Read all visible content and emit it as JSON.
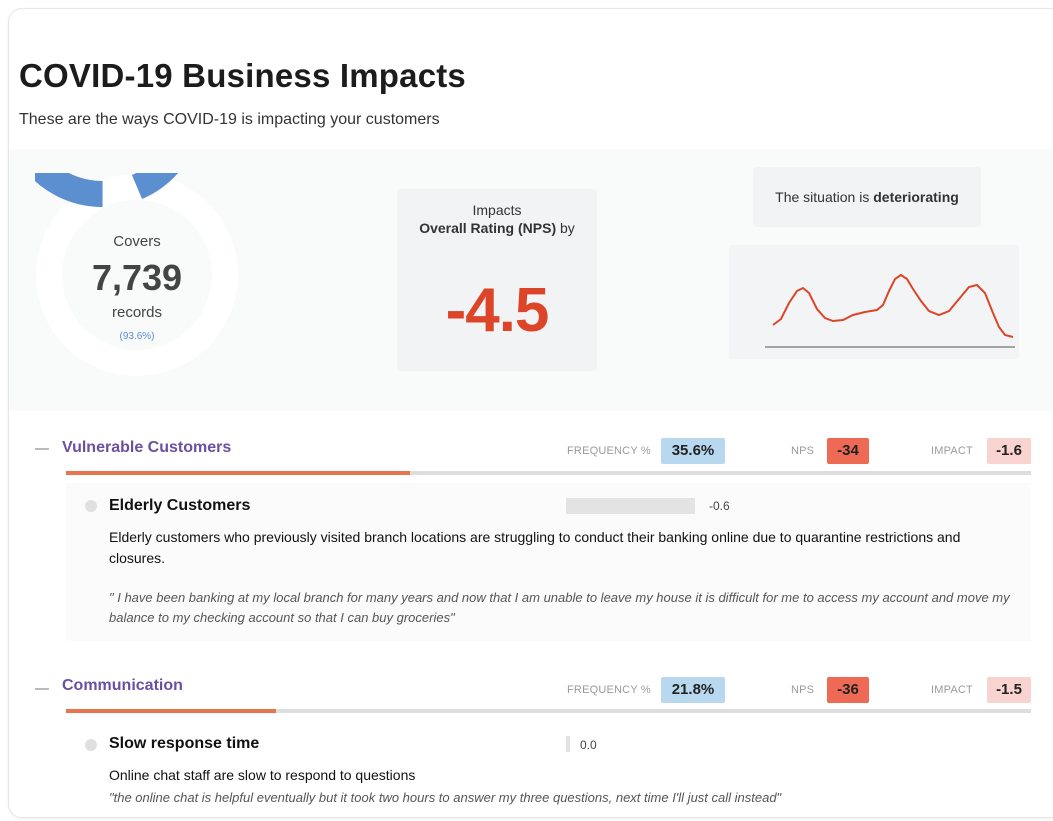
{
  "header": {
    "title": "COVID-19 Business Impacts",
    "subtitle": "These are the ways COVID-19 is impacting your customers"
  },
  "coverage": {
    "label": "Covers",
    "count": "7,739",
    "unit": "records",
    "percent_text": "(93.6%)",
    "percent_value": 93.6,
    "color": "#5b8fd0"
  },
  "impact": {
    "line1": "Impacts",
    "metric_name": "Overall Rating (NPS)",
    "by_word": "by",
    "value": "-4.5",
    "color": "#dd4528"
  },
  "trend": {
    "prefix": "The situation is",
    "status": "deteriorating",
    "line_color": "#dd4528",
    "points": [
      [
        0,
        42
      ],
      [
        8,
        36
      ],
      [
        16,
        20
      ],
      [
        24,
        8
      ],
      [
        30,
        5
      ],
      [
        36,
        10
      ],
      [
        44,
        26
      ],
      [
        52,
        35
      ],
      [
        60,
        38
      ],
      [
        70,
        37
      ],
      [
        80,
        32
      ],
      [
        92,
        29
      ],
      [
        104,
        27
      ],
      [
        110,
        22
      ],
      [
        116,
        8
      ],
      [
        122,
        -4
      ],
      [
        128,
        -8
      ],
      [
        134,
        -4
      ],
      [
        140,
        6
      ],
      [
        148,
        18
      ],
      [
        156,
        28
      ],
      [
        166,
        32
      ],
      [
        176,
        28
      ],
      [
        186,
        16
      ],
      [
        196,
        4
      ],
      [
        204,
        2
      ],
      [
        212,
        10
      ],
      [
        220,
        30
      ],
      [
        226,
        44
      ],
      [
        232,
        52
      ],
      [
        240,
        54
      ]
    ]
  },
  "sections": [
    {
      "name": "Vulnerable Customers",
      "frequency_label": "FREQUENCY %",
      "frequency": "35.6%",
      "frequency_fraction": 0.356,
      "nps_label": "NPS",
      "nps": "-34",
      "impact_label": "IMPACT",
      "impact": "-1.6",
      "items": [
        {
          "title": "Elderly Customers",
          "value": "-0.6",
          "bar_fraction": 0.95,
          "description": "Elderly customers who previously visited branch locations are struggling to conduct their banking online due to quarantine restrictions and closures.",
          "quote": "\" I have been banking at my local branch for many years and now that I am unable to leave my house it is difficult for me to access my account and move my balance to my checking account so that I can buy groceries\""
        }
      ]
    },
    {
      "name": "Communication",
      "frequency_label": "FREQUENCY %",
      "frequency": "21.8%",
      "frequency_fraction": 0.218,
      "nps_label": "NPS",
      "nps": "-36",
      "impact_label": "IMPACT",
      "impact": "-1.5",
      "items": [
        {
          "title": "Slow response time",
          "value": "0.0",
          "bar_fraction": 0.03,
          "description": "Online chat staff are slow to respond to questions",
          "quote": "\"the online chat is helpful eventually but it took two hours to answer my three questions, next time I'll just call instead\""
        }
      ]
    }
  ]
}
